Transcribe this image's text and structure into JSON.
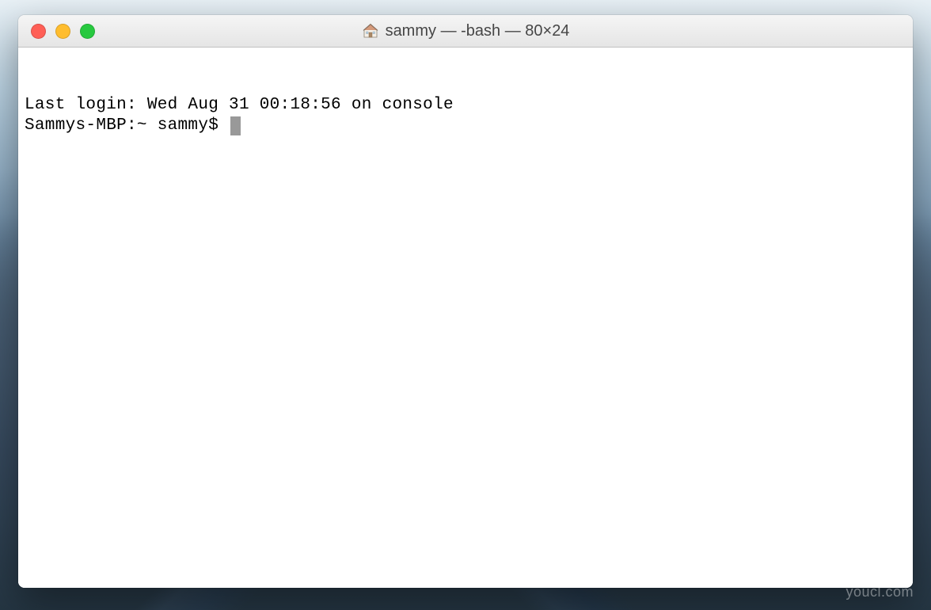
{
  "desktop": {
    "watermark": "youcl.com"
  },
  "window": {
    "title": "sammy — -bash — 80×24"
  },
  "terminal": {
    "last_login_line": "Last login: Wed Aug 31 00:18:56 on console",
    "prompt": "Sammys-MBP:~ sammy$ "
  }
}
